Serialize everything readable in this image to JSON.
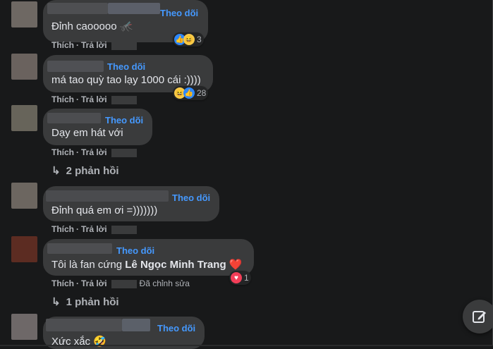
{
  "follow_label": "Theo dõi",
  "action_like": "Thích",
  "action_reply": "Trả lời",
  "comments": [
    {
      "text": "Đỉnh caooooo",
      "emoji": "🦟",
      "reactions": {
        "icons": [
          "like-icon",
          "haha-icon"
        ],
        "count": "3"
      }
    },
    {
      "text": "má tao quỳ tao lạy 1000 cái :))))",
      "reactions": {
        "icons": [
          "haha-icon",
          "like-icon"
        ],
        "count": "28"
      }
    },
    {
      "text": "Dạy em hát với",
      "replies": "2 phản hồi"
    },
    {
      "text": "Đỉnh quá em ơi =)))))))"
    },
    {
      "text_before": "Tôi là fan cứng ",
      "text_bold": "Lê Ngọc Minh Trang",
      "emoji": "❤️",
      "reactions": {
        "icons": [
          "love-icon"
        ],
        "count": "1"
      },
      "edited": "Đã chỉnh sửa",
      "replies": "1 phản hồi"
    },
    {
      "text": "Xức xắc",
      "emoji": "🤣"
    }
  ],
  "colors": {
    "background": "#18191a",
    "bubble": "#3a3b3c",
    "follow": "#4599ff",
    "text": "#e4e6eb",
    "muted": "#b0b3b8"
  }
}
